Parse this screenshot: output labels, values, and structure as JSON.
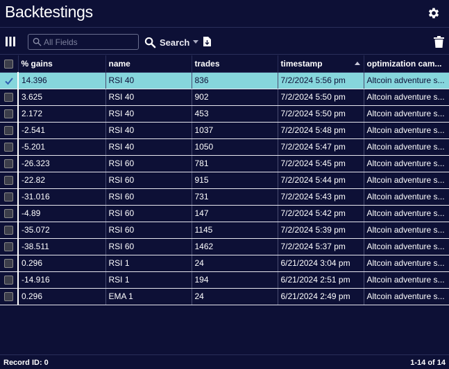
{
  "header": {
    "title": "Backtestings"
  },
  "toolbar": {
    "search_placeholder": "All Fields",
    "search_value": "",
    "search_label": "Search"
  },
  "columns": [
    "% gains",
    "name",
    "trades",
    "timestamp",
    "optimization cam..."
  ],
  "sort": {
    "column": "timestamp",
    "direction": "asc"
  },
  "rows": [
    {
      "checked": true,
      "gains": "14.396",
      "name": "RSI 40",
      "trades": "836",
      "timestamp": "7/2/2024 5:56 pm",
      "campaign": "Altcoin adventure s..."
    },
    {
      "checked": false,
      "gains": "3.625",
      "name": "RSI 40",
      "trades": "902",
      "timestamp": "7/2/2024 5:50 pm",
      "campaign": "Altcoin adventure s..."
    },
    {
      "checked": false,
      "gains": "2.172",
      "name": "RSI 40",
      "trades": "453",
      "timestamp": "7/2/2024 5:50 pm",
      "campaign": "Altcoin adventure s..."
    },
    {
      "checked": false,
      "gains": "-2.541",
      "name": "RSI 40",
      "trades": "1037",
      "timestamp": "7/2/2024 5:48 pm",
      "campaign": "Altcoin adventure s..."
    },
    {
      "checked": false,
      "gains": "-5.201",
      "name": "RSI 40",
      "trades": "1050",
      "timestamp": "7/2/2024 5:47 pm",
      "campaign": "Altcoin adventure s..."
    },
    {
      "checked": false,
      "gains": "-26.323",
      "name": "RSI 60",
      "trades": "781",
      "timestamp": "7/2/2024 5:45 pm",
      "campaign": "Altcoin adventure s..."
    },
    {
      "checked": false,
      "gains": "-22.82",
      "name": "RSI 60",
      "trades": "915",
      "timestamp": "7/2/2024 5:44 pm",
      "campaign": "Altcoin adventure s..."
    },
    {
      "checked": false,
      "gains": "-31.016",
      "name": "RSI 60",
      "trades": "731",
      "timestamp": "7/2/2024 5:43 pm",
      "campaign": "Altcoin adventure s..."
    },
    {
      "checked": false,
      "gains": "-4.89",
      "name": "RSI 60",
      "trades": "147",
      "timestamp": "7/2/2024 5:42 pm",
      "campaign": "Altcoin adventure s..."
    },
    {
      "checked": false,
      "gains": "-35.072",
      "name": "RSI 60",
      "trades": "1145",
      "timestamp": "7/2/2024 5:39 pm",
      "campaign": "Altcoin adventure s..."
    },
    {
      "checked": false,
      "gains": "-38.511",
      "name": "RSI 60",
      "trades": "1462",
      "timestamp": "7/2/2024 5:37 pm",
      "campaign": "Altcoin adventure s..."
    },
    {
      "checked": false,
      "gains": "0.296",
      "name": "RSI 1",
      "trades": "24",
      "timestamp": "6/21/2024 3:04 pm",
      "campaign": "Altcoin adventure s..."
    },
    {
      "checked": false,
      "gains": "-14.916",
      "name": "RSI 1",
      "trades": "194",
      "timestamp": "6/21/2024 2:51 pm",
      "campaign": "Altcoin adventure s..."
    },
    {
      "checked": false,
      "gains": "0.296",
      "name": "EMA 1",
      "trades": "24",
      "timestamp": "6/21/2024 2:49 pm",
      "campaign": "Altcoin adventure s..."
    }
  ],
  "footer": {
    "record_id": "Record ID: 0",
    "count": "1-14 of 14"
  },
  "colors": {
    "background": "#0d1036",
    "selected_row": "#86d6dc"
  },
  "icons": [
    "gear-icon",
    "columns-icon",
    "search-icon",
    "export-icon",
    "trash-icon",
    "checkmark-icon",
    "sort-up-icon"
  ]
}
